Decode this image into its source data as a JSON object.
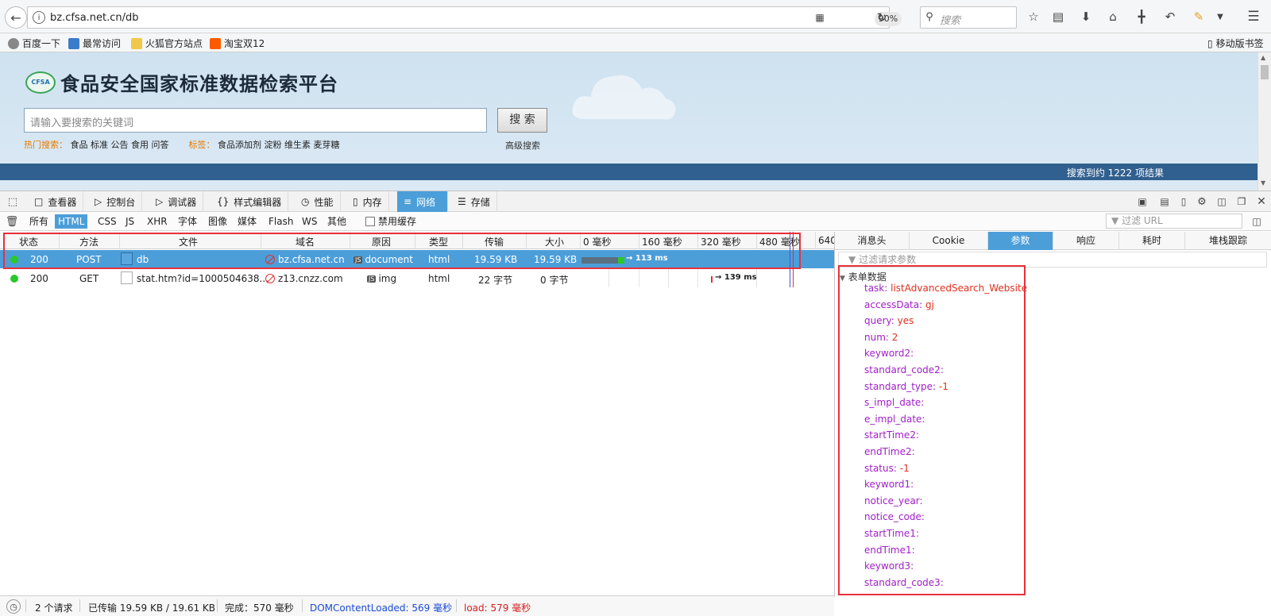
{
  "browser": {
    "url": "bz.cfsa.net.cn/db",
    "zoom": "90%",
    "search_placeholder": "搜索",
    "bookmarks": [
      "百度一下",
      "最常访问",
      "火狐官方站点",
      "淘宝双12"
    ],
    "mobile_bookmarks": "移动版书签"
  },
  "site": {
    "logo_text": "CFSA",
    "title": "食品安全国家标准数据检索平台",
    "search_placeholder": "请输入要搜索的关键词",
    "search_button": "搜 索",
    "hot_label": "热门搜索：",
    "hot_items": "食品 标准 公告 食用 问答",
    "tag_label": "标签：",
    "tag_items": "食品添加剂 淀粉 维生素 麦芽糖",
    "advanced": "高级搜索",
    "result_text": "搜索到约 1222 项结果"
  },
  "devtools": {
    "tabs": [
      "查看器",
      "控制台",
      "调试器",
      "样式编辑器",
      "性能",
      "内存",
      "网络",
      "存储"
    ],
    "active_tab": "网络",
    "filters": [
      "所有",
      "HTML",
      "CSS",
      "JS",
      "XHR",
      "字体",
      "图像",
      "媒体",
      "Flash",
      "WS",
      "其他"
    ],
    "active_filter": "HTML",
    "disable_cache": "禁用缓存",
    "url_filter_placeholder": "过滤 URL",
    "columns": [
      "状态",
      "方法",
      "文件",
      "域名",
      "原因",
      "类型",
      "传输",
      "大小"
    ],
    "timeline_ticks": [
      "0 毫秒",
      "160 毫秒",
      "320 毫秒",
      "480 毫秒",
      "640"
    ],
    "requests": [
      {
        "status": "200",
        "method": "POST",
        "file": "db",
        "domain": "bz.cfsa.net.cn",
        "cause": "document",
        "type": "html",
        "transferred": "19.59 KB",
        "size": "19.59 KB",
        "timing": "→ 113 ms"
      },
      {
        "status": "200",
        "method": "GET",
        "file": "stat.htm?id=1000504638...",
        "domain": "z13.cnzz.com",
        "cause": "img",
        "type": "html",
        "transferred": "22 字节",
        "size": "0 字节",
        "timing": "→ 139 ms"
      }
    ],
    "detail_tabs": [
      "消息头",
      "Cookie",
      "参数",
      "响应",
      "耗时",
      "堆栈跟踪"
    ],
    "active_detail_tab": "参数",
    "params_filter_placeholder": "过滤请求参数",
    "form_data_label": "表单数据",
    "params": [
      {
        "k": "task",
        "v": "listAdvancedSearch_Website"
      },
      {
        "k": "accessData",
        "v": "gj"
      },
      {
        "k": "query",
        "v": "yes"
      },
      {
        "k": "num",
        "v": "2"
      },
      {
        "k": "keyword2",
        "v": ""
      },
      {
        "k": "standard_code2",
        "v": ""
      },
      {
        "k": "standard_type",
        "v": "-1"
      },
      {
        "k": "s_impl_date",
        "v": ""
      },
      {
        "k": "e_impl_date",
        "v": ""
      },
      {
        "k": "startTime2",
        "v": ""
      },
      {
        "k": "endTime2",
        "v": ""
      },
      {
        "k": "status",
        "v": "-1"
      },
      {
        "k": "keyword1",
        "v": ""
      },
      {
        "k": "notice_year",
        "v": ""
      },
      {
        "k": "notice_code",
        "v": ""
      },
      {
        "k": "startTime1",
        "v": ""
      },
      {
        "k": "endTime1",
        "v": ""
      },
      {
        "k": "keyword3",
        "v": ""
      },
      {
        "k": "standard_code3",
        "v": ""
      }
    ],
    "status_bar": {
      "requests": "2 个请求",
      "transferred": "已传输 19.59 KB / 19.61 KB",
      "finish": "完成：570 毫秒",
      "dom_loaded": "DOMContentLoaded: 569 毫秒",
      "load": "load: 579 毫秒"
    }
  },
  "colors": {
    "accent": "#4c9ed9",
    "param_key": "#a020c8",
    "param_value": "#e0301e",
    "highlight": "#e8303a"
  }
}
